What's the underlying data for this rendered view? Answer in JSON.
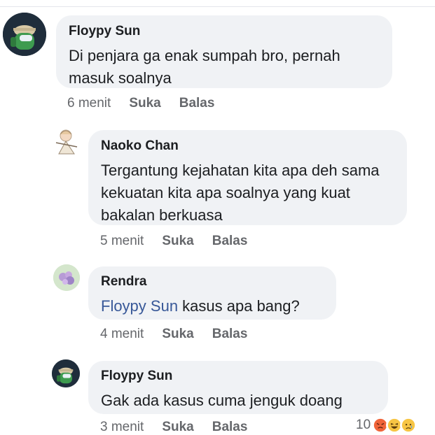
{
  "comments": [
    {
      "author": "Floypy Sun",
      "text": "Di penjara ga enak sumpah bro, pernah masuk soalnya",
      "time": "6 menit",
      "like": "Suka",
      "reply": "Balas"
    },
    {
      "author": "Naoko Chan",
      "text": "Tergantung kejahatan kita apa deh sama kekuatan kita apa soalnya yang kuat bakalan berkuasa",
      "time": "5 menit",
      "like": "Suka",
      "reply": "Balas"
    },
    {
      "author": "Rendra",
      "mention": "Floypy Sun",
      "text": " kasus apa bang?",
      "time": "4 menit",
      "like": "Suka",
      "reply": "Balas"
    },
    {
      "author": "Floypy Sun",
      "text": "Gak ada kasus cuma jenguk doang",
      "time": "3 menit",
      "like": "Suka",
      "reply": "Balas",
      "reaction_count": "10",
      "reaction_icons": [
        "angry-icon",
        "haha-icon",
        "sad-icon"
      ]
    }
  ],
  "colors": {
    "bubble": "#f0f2f5",
    "meta": "#65676b",
    "mention": "#385898",
    "angry": "#f0643a",
    "haha": "#f7c544"
  }
}
